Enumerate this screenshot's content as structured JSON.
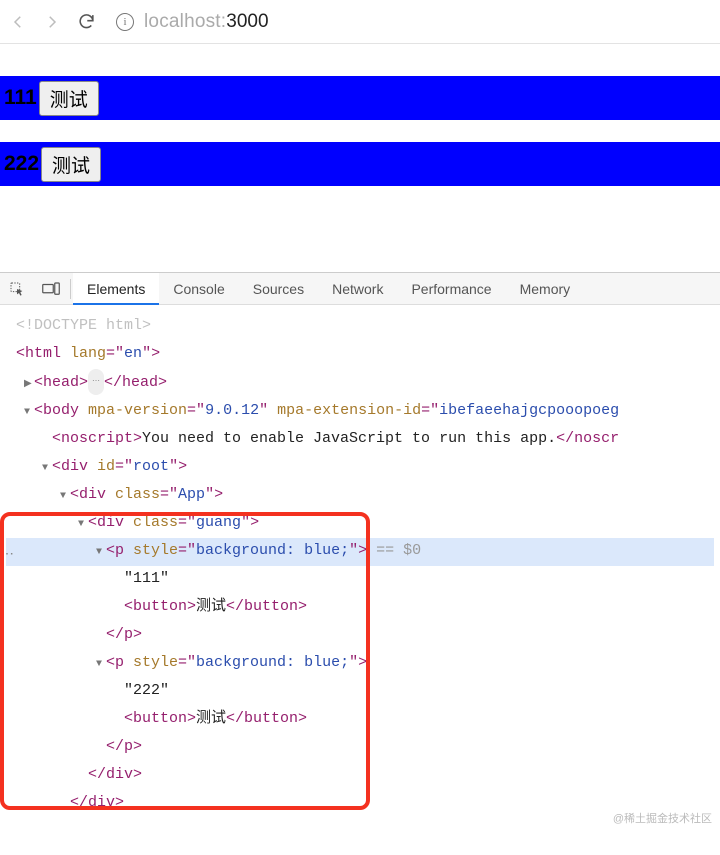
{
  "toolbar": {
    "url_host": "localhost:",
    "url_port_path": "3000"
  },
  "viewport": {
    "rows": [
      {
        "text": "111",
        "button": "测试"
      },
      {
        "text": "222",
        "button": "测试"
      }
    ]
  },
  "devtools": {
    "tabs": [
      "Elements",
      "Console",
      "Sources",
      "Network",
      "Performance",
      "Memory"
    ],
    "active_tab": "Elements",
    "dom": {
      "doctype": "<!DOCTYPE html>",
      "html_open": {
        "tag": "html",
        "attrs": [
          [
            "lang",
            "en"
          ]
        ]
      },
      "head": "head",
      "body_open": {
        "tag": "body",
        "attrs": [
          [
            "mpa-version",
            "9.0.12"
          ],
          [
            "mpa-extension-id",
            "ibefaeehajgcpooopoeg"
          ]
        ]
      },
      "noscript": {
        "tag": "noscript",
        "text": "You need to enable JavaScript to run this app."
      },
      "div_root": {
        "tag": "div",
        "attrs": [
          [
            "id",
            "root"
          ]
        ]
      },
      "div_app": {
        "tag": "div",
        "attrs": [
          [
            "class",
            "App"
          ]
        ]
      },
      "div_guang": {
        "tag": "div",
        "attrs": [
          [
            "class",
            "guang"
          ]
        ]
      },
      "p1": {
        "tag": "p",
        "attrs": [
          [
            "style",
            "background: blue;"
          ]
        ],
        "text": "111",
        "button": "测试",
        "selected_marker": "== $0"
      },
      "p2": {
        "tag": "p",
        "attrs": [
          [
            "style",
            "background: blue;"
          ]
        ],
        "text": "222",
        "button": "测试"
      },
      "close_div": "</div>"
    }
  },
  "watermark": "@稀土掘金技术社区"
}
